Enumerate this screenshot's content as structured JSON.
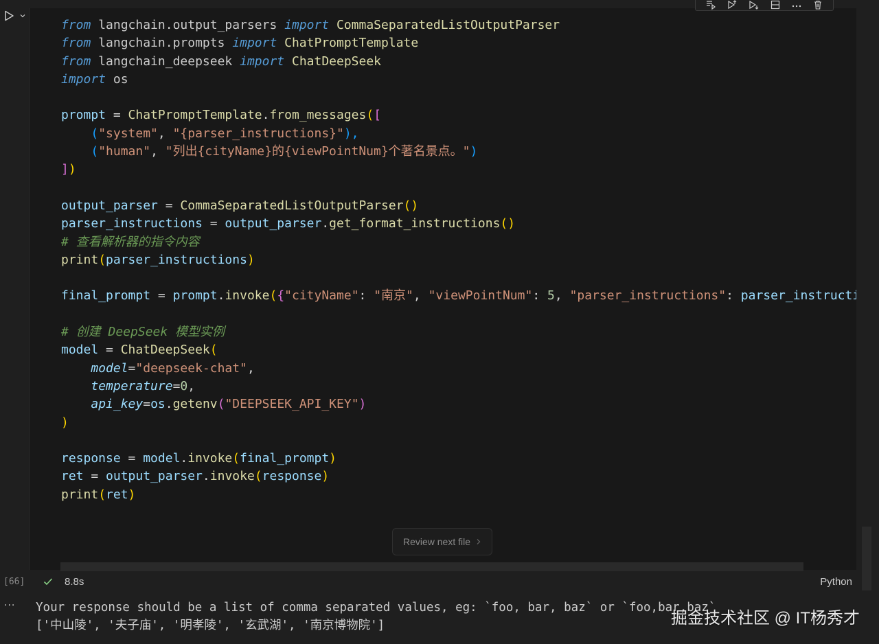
{
  "toolbar": {
    "buttons": [
      "run-by-line-icon",
      "execute-above-icon",
      "execute-below-icon",
      "split-cell-icon",
      "more-icon",
      "delete-icon"
    ]
  },
  "code": {
    "l1": {
      "a": "from",
      "b": " langchain.output_parsers ",
      "c": "import",
      "d": " CommaSeparatedListOutputParser"
    },
    "l2": {
      "a": "from",
      "b": " langchain.prompts ",
      "c": "import",
      "d": " ChatPromptTemplate"
    },
    "l3": {
      "a": "from",
      "b": " langchain_deepseek ",
      "c": "import",
      "d": " ChatDeepSeek"
    },
    "l4": {
      "a": "import",
      "b": " os"
    },
    "l6": {
      "a": "prompt",
      "b": " = ",
      "c": "ChatPromptTemplate",
      "d": ".",
      "e": "from_messages",
      "f": "(",
      "g": "["
    },
    "l7": {
      "a": "    ",
      "b": "(",
      "c": "\"system\"",
      "d": ", ",
      "e": "\"{parser_instructions}\"",
      "f": "),"
    },
    "l8": {
      "a": "    ",
      "b": "(",
      "c": "\"human\"",
      "d": ", ",
      "e": "\"列出{cityName}的{viewPointNum}个著名景点。\"",
      "f": ")"
    },
    "l9": {
      "a": "]",
      "b": ")"
    },
    "l11": {
      "a": "output_parser",
      "b": " = ",
      "c": "CommaSeparatedListOutputParser",
      "d": "()"
    },
    "l12": {
      "a": "parser_instructions",
      "b": " = ",
      "c": "output_parser",
      "d": ".",
      "e": "get_format_instructions",
      "f": "()"
    },
    "l13": {
      "a": "# 查看解析器的指令内容"
    },
    "l14": {
      "a": "print",
      "b": "(",
      "c": "parser_instructions",
      "d": ")"
    },
    "l16": {
      "a": "final_prompt",
      "b": " = ",
      "c": "prompt",
      "d": ".",
      "e": "invoke",
      "f": "(",
      "g": "{",
      "h": "\"cityName\"",
      "i": ": ",
      "j": "\"南京\"",
      "k": ", ",
      "l": "\"viewPointNum\"",
      "m": ": ",
      "n": "5",
      "o": ", ",
      "p": "\"parser_instructions\"",
      "q": ": ",
      "r": "parser_instructions"
    },
    "l18": {
      "a": "# 创建 DeepSeek 模型实例"
    },
    "l19": {
      "a": "model",
      "b": " = ",
      "c": "ChatDeepSeek",
      "d": "("
    },
    "l20": {
      "a": "    ",
      "b": "model",
      "c": "=",
      "d": "\"deepseek-chat\"",
      "e": ","
    },
    "l21": {
      "a": "    ",
      "b": "temperature",
      "c": "=",
      "d": "0",
      "e": ","
    },
    "l22": {
      "a": "    ",
      "b": "api_key",
      "c": "=",
      "d": "os",
      "e": ".",
      "f": "getenv",
      "g": "(",
      "h": "\"DEEPSEEK_API_KEY\"",
      "i": ")"
    },
    "l23": {
      "a": ")"
    },
    "l25": {
      "a": "response",
      "b": " = ",
      "c": "model",
      "d": ".",
      "e": "invoke",
      "f": "(",
      "g": "final_prompt",
      "h": ")"
    },
    "l26": {
      "a": "ret",
      "b": " = ",
      "c": "output_parser",
      "d": ".",
      "e": "invoke",
      "f": "(",
      "g": "response",
      "h": ")"
    },
    "l27": {
      "a": "print",
      "b": "(",
      "c": "ret",
      "d": ")"
    }
  },
  "review_button": {
    "label": "Review next file",
    "icon": "chevron-right-icon"
  },
  "status": {
    "exec_count": "[66]",
    "duration": "8.8s",
    "language": "Python"
  },
  "output": {
    "more": "···",
    "line1": "Your response should be a list of comma separated values, eg: `foo, bar, baz` or `foo,bar,baz`",
    "line2": "['中山陵', '夫子庙', '明孝陵', '玄武湖', '南京博物院']"
  },
  "watermark": "掘金技术社区 @ IT杨秀才"
}
